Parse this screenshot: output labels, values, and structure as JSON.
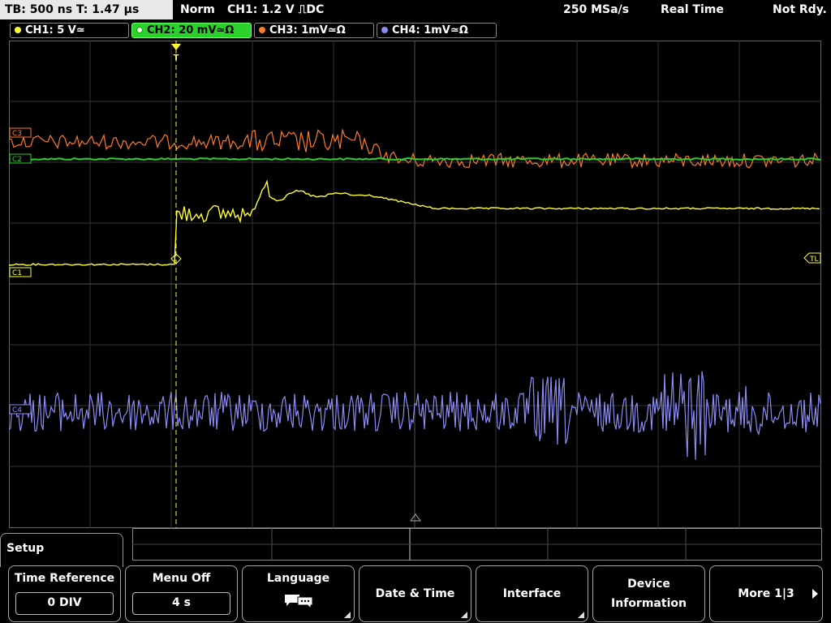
{
  "topbar": {
    "timebase": "TB: 500 ns   T: 1.47 µs",
    "trigger_mode": "Norm",
    "trigger_info": "CH1: 1.2 V ⎍DC",
    "sample_rate": "250 MSa/s",
    "acq_mode": "Real Time",
    "status": "Not Rdy."
  },
  "channels": [
    {
      "label": "CH1: 5 V≃",
      "color": "#ffff33"
    },
    {
      "label": "CH2: 20 mV≃Ω",
      "color": "#2bd02b"
    },
    {
      "label": "CH3: 1mV≃Ω",
      "color": "#ff7a2a"
    },
    {
      "label": "CH4: 1mV≃Ω",
      "color": "#8c8cf5"
    }
  ],
  "markers": {
    "c1": "C1",
    "c2": "C2",
    "c3": "C3",
    "c4": "C4",
    "tl": "TL",
    "trigger_top": "T"
  },
  "menu": {
    "title": "Setup",
    "softkeys": [
      {
        "title": "Time Reference",
        "value": "0 DIV"
      },
      {
        "title": "Menu Off",
        "value": "4 s"
      },
      {
        "title": "Language",
        "icon": "speech-bubble-icon"
      },
      {
        "title": "Date & Time"
      },
      {
        "title": "Interface"
      },
      {
        "title_line1": "Device",
        "title_line2": "Information"
      },
      {
        "title": "More 1|3"
      }
    ]
  }
}
